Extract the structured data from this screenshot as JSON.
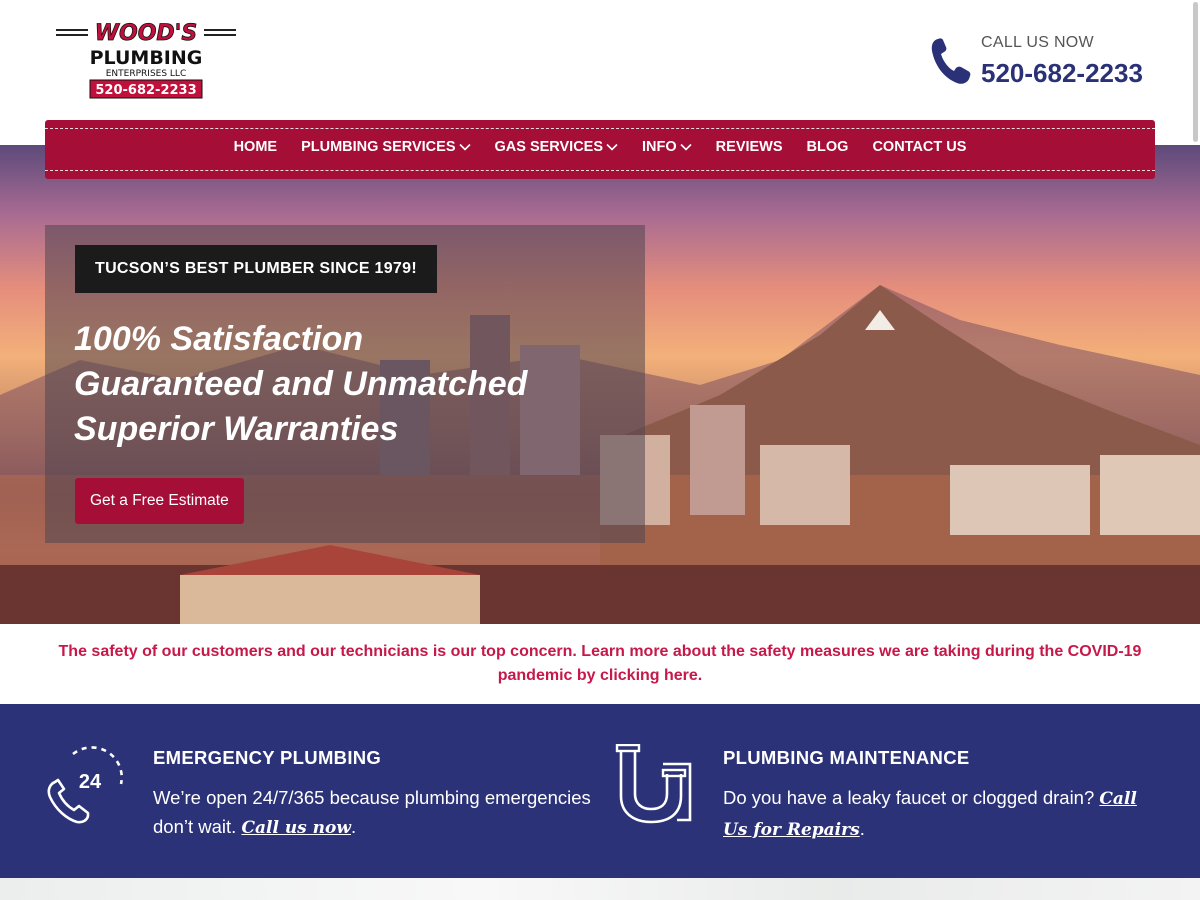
{
  "logo": {
    "line1": "WOOD'S",
    "line2": "PLUMBING",
    "line3": "ENTERPRISES   LLC",
    "phone": "520-682-2233"
  },
  "header": {
    "call_label": "CALL US NOW",
    "call_number": "520-682-2233"
  },
  "nav": {
    "items": [
      {
        "label": "HOME",
        "dropdown": false
      },
      {
        "label": "PLUMBING SERVICES",
        "dropdown": true
      },
      {
        "label": "GAS SERVICES",
        "dropdown": true
      },
      {
        "label": "INFO",
        "dropdown": true
      },
      {
        "label": "REVIEWS",
        "dropdown": false
      },
      {
        "label": "BLOG",
        "dropdown": false
      },
      {
        "label": "CONTACT US",
        "dropdown": false
      }
    ]
  },
  "hero": {
    "badge": "TUCSON’S BEST PLUMBER SINCE 1979!",
    "headline_line1": "100% Satisfaction",
    "headline_line2": "Guaranteed and Unmatched",
    "headline_line3": "Superior Warranties",
    "cta_label": "Get a Free Estimate"
  },
  "notice": {
    "text": "The safety of our customers and our technicians is our top concern. Learn more about the safety measures we are taking during the COVID-19 pandemic by clicking here."
  },
  "services": [
    {
      "icon": "phone-24-icon",
      "title": "EMERGENCY PLUMBING",
      "desc": "We’re open 24/7/365 because plumbing emergencies don’t wait. ",
      "link": "Call us now",
      "suffix": "."
    },
    {
      "icon": "pipe-trap-icon",
      "title": "PLUMBING MAINTENANCE",
      "desc": "Do you have a leaky faucet or clogged drain? ",
      "link": "Call Us for Repairs",
      "suffix": "."
    }
  ],
  "colors": {
    "brand_red": "#a50e36",
    "brand_navy": "#2b3278",
    "notice_text": "#c7184a"
  }
}
